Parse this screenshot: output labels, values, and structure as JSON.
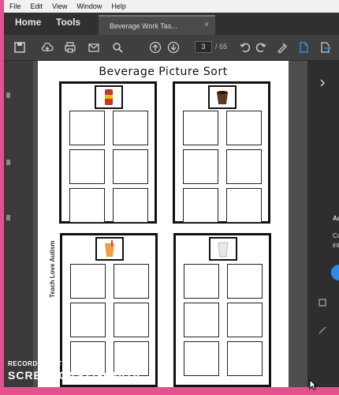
{
  "menu": [
    "File",
    "Edit",
    "View",
    "Window",
    "Help"
  ],
  "tabs": {
    "home": "Home",
    "tools": "Tools",
    "document": "Beverage Work Tas...",
    "close": "×"
  },
  "toolbar": {
    "icons": [
      "cloud-upload-icon",
      "print-icon",
      "mail-icon",
      "search-icon",
      "page-up-icon",
      "page-down-icon",
      "rotate-ccw-icon",
      "rotate-cw-icon",
      "sign-icon",
      "document-icon",
      "export-icon"
    ],
    "current_page": "3",
    "total_pages": "/ 65"
  },
  "page": {
    "title": "Beverage Picture Sort",
    "credit": "Teach Love Autism",
    "categories": [
      {
        "name": "soda can",
        "color": "#c0392b"
      },
      {
        "name": "coffee cup",
        "color": "#5b3a1e"
      },
      {
        "name": "orange juice",
        "color": "#f0a040"
      },
      {
        "name": "milk",
        "color": "#e8e8e8"
      }
    ]
  },
  "right_panel": {
    "line1": "Ad",
    "line2": "Co",
    "line3": "int",
    "accent": "#2d8ceb"
  },
  "watermark": {
    "line1": "RECORDED WITH",
    "line2a": "SCREENCAST",
    "line2b": "MATIC"
  },
  "colors": {
    "frame": "#e7508f",
    "chrome": "#3b3b3b",
    "accent": "#2d8ceb"
  }
}
